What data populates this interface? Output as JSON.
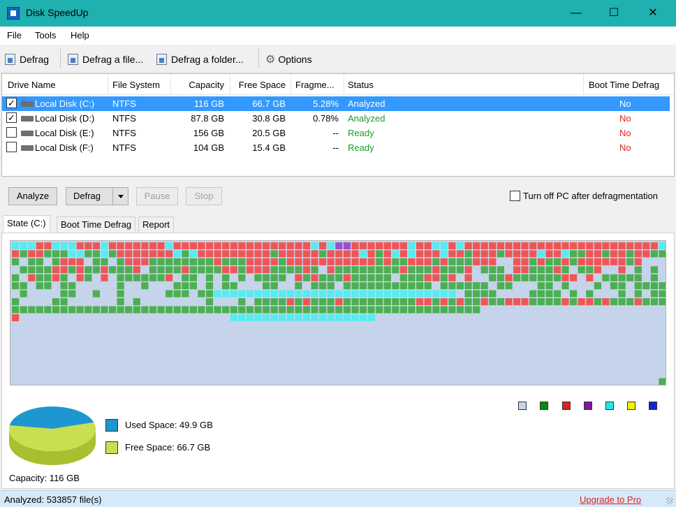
{
  "window": {
    "title": "Disk SpeedUp"
  },
  "window_controls": {
    "minimize": "—",
    "maximize": "☐",
    "close": "✕"
  },
  "menu": {
    "file": "File",
    "tools": "Tools",
    "help": "Help"
  },
  "toolbar": {
    "defrag": "Defrag",
    "defrag_file": "Defrag a file...",
    "defrag_folder": "Defrag a folder...",
    "options": "Options"
  },
  "columns": {
    "drive_name": "Drive Name",
    "file_system": "File System",
    "capacity": "Capacity",
    "free_space": "Free Space",
    "fragmented": "Fragme...",
    "status": "Status",
    "boot_time_defrag": "Boot Time Defrag"
  },
  "drives": [
    {
      "name": "Local Disk (C:)",
      "fs": "NTFS",
      "capacity": "116 GB",
      "free": "66.7 GB",
      "frag": "5.28%",
      "status": "Analyzed",
      "boot": "No",
      "checked": true,
      "selected": true
    },
    {
      "name": "Local Disk (D:)",
      "fs": "NTFS",
      "capacity": "87.8 GB",
      "free": "30.8 GB",
      "frag": "0.78%",
      "status": "Analyzed",
      "boot": "No",
      "checked": true,
      "selected": false
    },
    {
      "name": "Local Disk (E:)",
      "fs": "NTFS",
      "capacity": "156 GB",
      "free": "20.5 GB",
      "frag": "--",
      "status": "Ready",
      "boot": "No",
      "checked": false,
      "selected": false
    },
    {
      "name": "Local Disk (F:)",
      "fs": "NTFS",
      "capacity": "104 GB",
      "free": "15.4 GB",
      "frag": "--",
      "status": "Ready",
      "boot": "No",
      "checked": false,
      "selected": false
    }
  ],
  "actions": {
    "analyze": "Analyze",
    "defrag": "Defrag",
    "pause": "Pause",
    "stop": "Stop",
    "turn_off": "Turn off PC after defragmentation"
  },
  "tabs": {
    "state": "State (C:)",
    "boot": "Boot Time Defrag",
    "report": "Report"
  },
  "legend_colors": [
    "#c5d4ea",
    "#0a8a0a",
    "#e02020",
    "#7a1a9a",
    "#22e6f0",
    "#f5f000",
    "#1028d0"
  ],
  "map_colors": {
    "free": "#c5d4ea",
    "used": "#4caf50",
    "fragmented": "#f05555",
    "moving": "#55ecf0",
    "system": "#9c4dcc"
  },
  "pie": {
    "used_label": "Used Space: 49.9 GB",
    "free_label": "Free Space: 66.7 GB",
    "capacity_label": "Capacity: 116 GB",
    "used_color": "#1e96d0",
    "free_color": "#c8e050",
    "used_gb": 49.9,
    "free_gb": 66.7
  },
  "status_bar": {
    "analyzed": "Analyzed: 533857 file(s)",
    "upgrade": "Upgrade to Pro"
  }
}
